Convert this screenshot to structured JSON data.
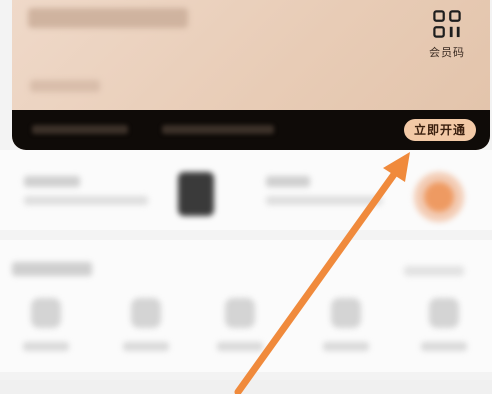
{
  "card": {
    "qr_label": "会员码",
    "open_button": "立即开通",
    "qr_icon": "qr-code-icon"
  },
  "annotation": {
    "arrow_color": "#f08a3c"
  },
  "colors": {
    "card_gradient_start": "#efd9c9",
    "card_strip": "#0f0b08",
    "button_bg": "#f2c9a6",
    "accent": "#ee9a62"
  }
}
